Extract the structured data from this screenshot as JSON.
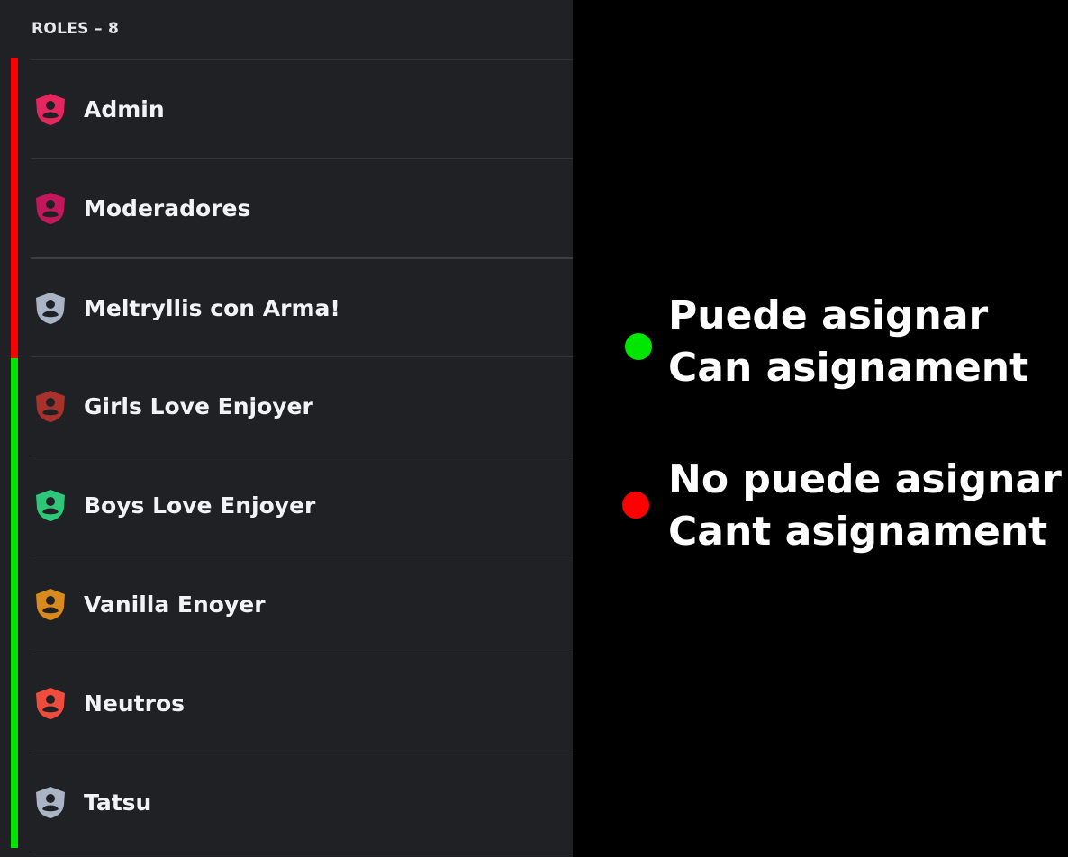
{
  "header": {
    "title": "ROLES – 8"
  },
  "roles": [
    {
      "name": "Admin",
      "icon": "shield-user-icon",
      "color": "#e6245d"
    },
    {
      "name": "Moderadores",
      "icon": "shield-user-icon",
      "color": "#c2185b"
    },
    {
      "name": "Meltryllis con Arma!",
      "icon": "shield-user-icon",
      "color": "#a9b5c4"
    },
    {
      "name": "Girls Love Enjoyer",
      "icon": "shield-user-icon",
      "color": "#a8322b"
    },
    {
      "name": "Boys Love Enjoyer",
      "icon": "shield-user-icon",
      "color": "#2ec77a"
    },
    {
      "name": "Vanilla Enoyer",
      "icon": "shield-user-icon",
      "color": "#d98a1f"
    },
    {
      "name": "Neutros",
      "icon": "shield-user-icon",
      "color": "#f04c3e"
    },
    {
      "name": "Tatsu",
      "icon": "shield-user-icon",
      "color": "#a9b5c4"
    }
  ],
  "indicators": {
    "cannot_color": "#ff0000",
    "can_color": "#00e600"
  },
  "legend": {
    "can": {
      "line1": "Puede asignar",
      "line2": "Can asignament",
      "color": "#00e600"
    },
    "cannot": {
      "line1": "No puede asignar",
      "line2": "Cant asignament",
      "color": "#ff0000"
    }
  }
}
